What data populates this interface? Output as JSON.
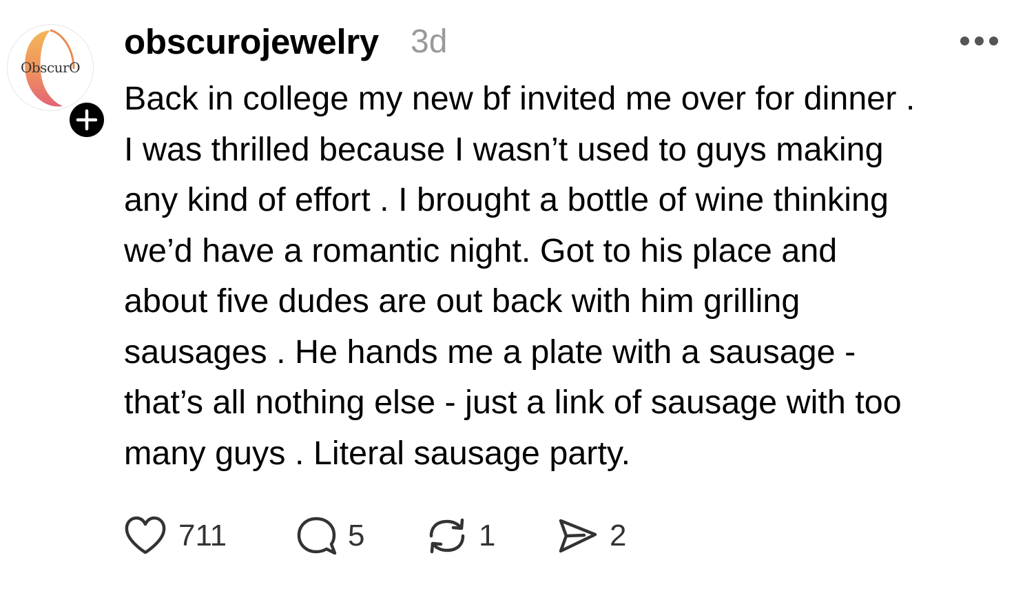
{
  "post": {
    "avatar": {
      "logo_text": "ObscurO",
      "badge_icon": "plus-icon"
    },
    "username": "obscurojewelry",
    "timestamp": "3d",
    "more_icon": "more-horizontal-icon",
    "body_lines": [
      "Back in college my new bf invited me over for dinner .",
      "I was thrilled because I wasn’t used to guys making",
      "any kind of effort . I brought a bottle of wine thinking",
      "we’d have a romantic night. Got to his place and",
      "about five dudes are out back with him grilling",
      "sausages . He hands me a plate with a sausage -",
      "that’s all nothing else - just a link of sausage with too",
      "many guys . Literal sausage party."
    ],
    "actions": {
      "likes": {
        "icon": "heart-icon",
        "count": "711"
      },
      "replies": {
        "icon": "comment-icon",
        "count": "5"
      },
      "reposts": {
        "icon": "repost-icon",
        "count": "1"
      },
      "shares": {
        "icon": "send-icon",
        "count": "2"
      }
    }
  },
  "colors": {
    "text": "#000000",
    "secondary_text": "#999999",
    "icon": "#333333",
    "logo_gradient_start": "#f2b24a",
    "logo_gradient_end": "#e0566a"
  }
}
